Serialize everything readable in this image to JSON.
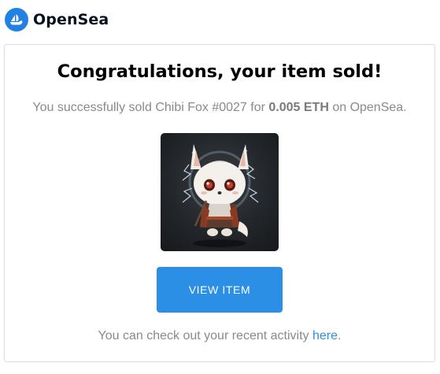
{
  "header": {
    "brand": "OpenSea",
    "logo_icon": "opensea-boat-icon"
  },
  "email": {
    "title": "Congratulations, your item sold!",
    "message_prefix": "You successfully sold Chibi Fox #0027 for ",
    "price": "0.005 ETH",
    "message_suffix": " on OpenSea.",
    "view_button_label": "VIEW ITEM",
    "footer_prefix": "You can check out your recent activity ",
    "footer_link": "here",
    "footer_suffix": "."
  },
  "colors": {
    "brand_blue": "#2081e2",
    "button_blue": "#2b8fe6",
    "text_gray": "#8a8a8a"
  }
}
